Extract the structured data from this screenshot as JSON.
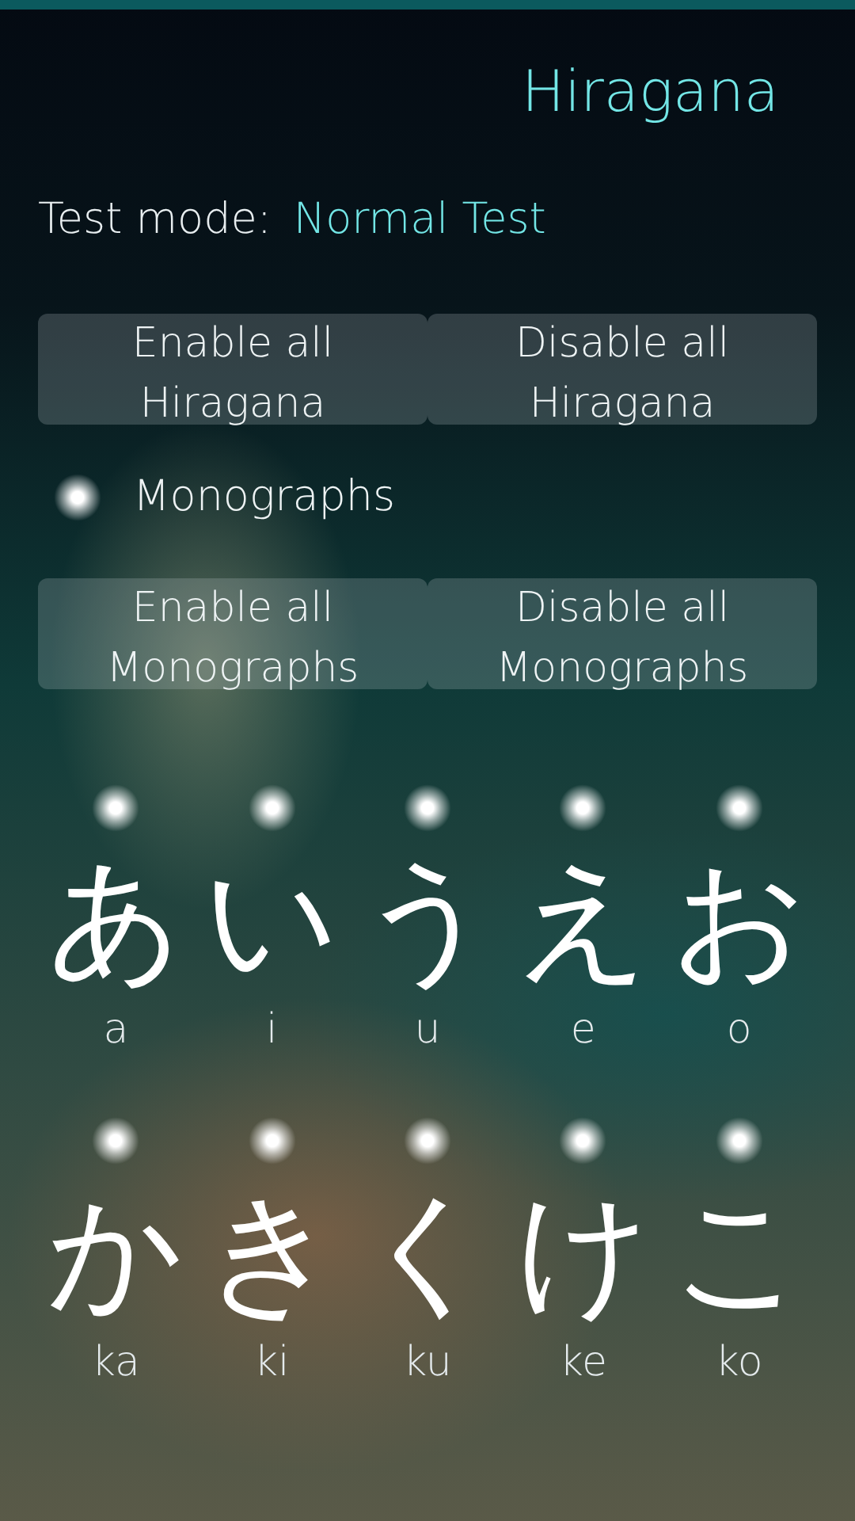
{
  "header": {
    "title": "Hiragana"
  },
  "test_mode": {
    "label": "Test mode:",
    "value": "Normal Test"
  },
  "group_buttons": [
    {
      "label": "Enable all Hiragana"
    },
    {
      "label": "Disable all Hiragana"
    }
  ],
  "sections": [
    {
      "title": "Monographs",
      "checked": true,
      "buttons": [
        {
          "label": "Enable all Monographs"
        },
        {
          "label": "Disable all Monographs"
        }
      ],
      "rows": [
        [
          {
            "kana": "あ",
            "romaji": "a",
            "checked": true
          },
          {
            "kana": "い",
            "romaji": "i",
            "checked": true
          },
          {
            "kana": "う",
            "romaji": "u",
            "checked": true
          },
          {
            "kana": "え",
            "romaji": "e",
            "checked": true
          },
          {
            "kana": "お",
            "romaji": "o",
            "checked": true
          }
        ],
        [
          {
            "kana": "か",
            "romaji": "ka",
            "checked": true
          },
          {
            "kana": "き",
            "romaji": "ki",
            "checked": true
          },
          {
            "kana": "く",
            "romaji": "ku",
            "checked": true
          },
          {
            "kana": "け",
            "romaji": "ke",
            "checked": true
          },
          {
            "kana": "こ",
            "romaji": "ko",
            "checked": true
          }
        ]
      ]
    }
  ]
}
